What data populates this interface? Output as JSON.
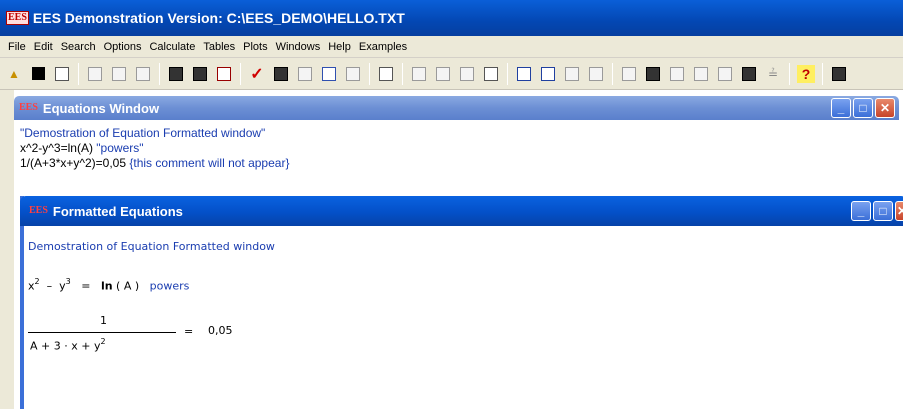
{
  "app": {
    "title": "EES Demonstration Version:  C:\\EES_DEMO\\HELLO.TXT",
    "logo": "EES"
  },
  "menu": [
    "File",
    "Edit",
    "Search",
    "Options",
    "Calculate",
    "Tables",
    "Plots",
    "Windows",
    "Help",
    "Examples"
  ],
  "toolbar_icons": [
    "open-icon",
    "save-icon",
    "print-icon",
    "find-icon",
    "replace-icon",
    "check-icon",
    "equations-icon",
    "formatted-icon",
    "unit-icon",
    "solve-check-icon",
    "parametric-icon",
    "plot-icon",
    "graph-icon",
    "table-icon",
    "help-icon",
    "calculator-icon"
  ],
  "equations_window": {
    "title": "Equations Window",
    "lines": [
      {
        "code": "",
        "comment": "\"Demostration of Equation Formatted window\""
      },
      {
        "code": "x^2-y^3=ln(A) ",
        "comment": "\"powers\""
      },
      {
        "code": "1/(A+3*x+y^2)=0,05 ",
        "comment": "{this comment will not appear}"
      }
    ]
  },
  "formatted_window": {
    "title": "Formatted Equations",
    "heading": "Demostration of Equation Formatted window",
    "eq1": {
      "x": "x",
      "exp2": "2",
      "minus": "–",
      "y": "y",
      "exp3": "3",
      "equals": "=",
      "ln": "ln",
      "arg": "( A )",
      "comment": "powers"
    },
    "eq2": {
      "numerator": "1",
      "denominator": "A  +  3  ·  x  +  y",
      "den_exp": "2",
      "equals": "=",
      "value": "0,05"
    }
  }
}
